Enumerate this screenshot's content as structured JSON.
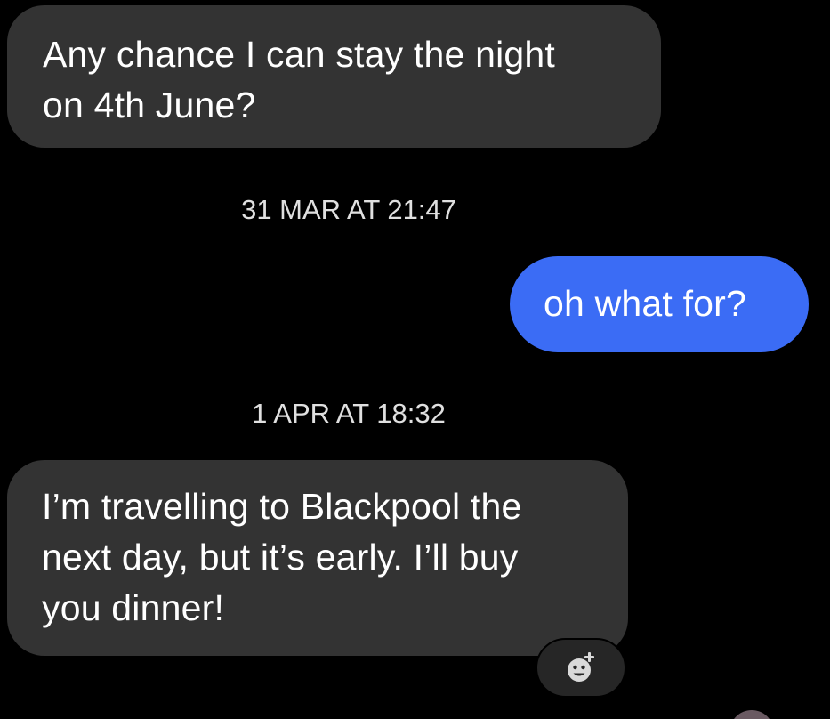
{
  "conversation": {
    "messages": [
      {
        "direction": "incoming",
        "lines": [
          "Any chance I can stay the night",
          "on 4th June?"
        ]
      },
      {
        "direction": "outgoing",
        "lines": [
          "oh what for?"
        ]
      },
      {
        "direction": "incoming",
        "lines": [
          "I’m travelling to Blackpool the",
          "next day, but it’s early. I’ll buy",
          "you dinner!"
        ]
      }
    ],
    "timestamps": [
      "31 MAR AT 21:47",
      "1 APR AT 18:32"
    ],
    "reaction_icon": "add-reaction-icon"
  },
  "colors": {
    "background": "#000000",
    "incoming_bubble": "#333333",
    "outgoing_bubble": "#3b6cf5",
    "text": "#ffffff",
    "timestamp_text": "#e0e0e0"
  }
}
